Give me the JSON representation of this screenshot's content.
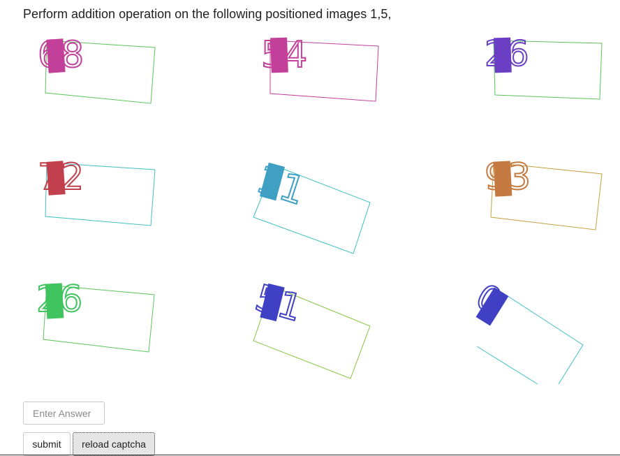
{
  "instruction": "Perform addition operation on the following positioned images 1,5,",
  "captcha_cells": [
    {
      "digits": "68",
      "color": "#c2409a",
      "box_color": "#5cc45a"
    },
    {
      "digits": "54",
      "color": "#c2409a",
      "box_color": "#c2409a"
    },
    {
      "digits": "26",
      "color": "#6a3fc4",
      "box_color": "#5cc45a"
    },
    {
      "digits": "72",
      "color": "#c2404e",
      "box_color": "#40c0c0"
    },
    {
      "digits": "11",
      "color": "#40a0c4",
      "box_color": "#40c0c0"
    },
    {
      "digits": "93",
      "color": "#c47a40",
      "box_color": "#c4a040"
    },
    {
      "digits": "26",
      "color": "#40c460",
      "box_color": "#5cc45a"
    },
    {
      "digits": "51",
      "color": "#4040c4",
      "box_color": "#8ac440"
    },
    {
      "digits": "0",
      "color": "#4040c4",
      "box_color": "#40c0c0"
    }
  ],
  "answer": {
    "placeholder": "Enter Answer",
    "value": ""
  },
  "buttons": {
    "submit": "submit",
    "reload": "reload captcha"
  }
}
